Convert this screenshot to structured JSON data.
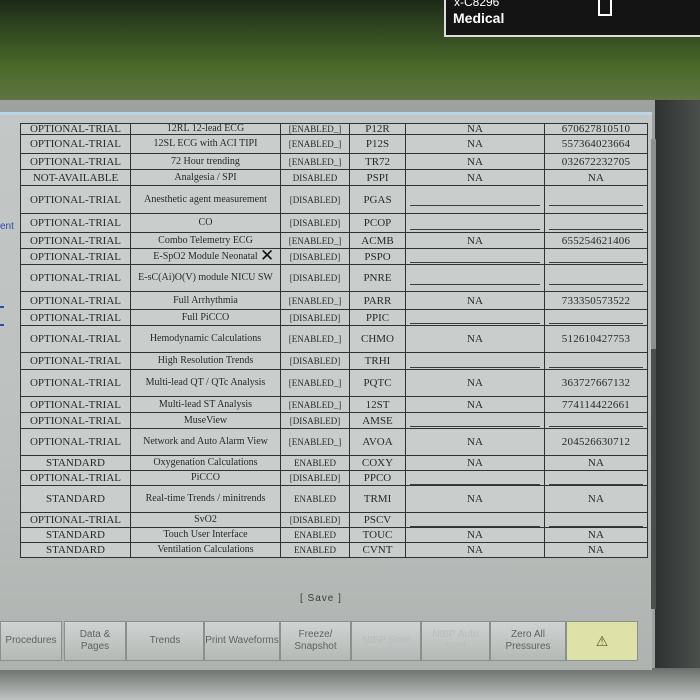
{
  "sticker": {
    "line1": "x-C8296",
    "line2": "Medical"
  },
  "side_hint": "ent",
  "table": {
    "rows": [
      {
        "license": "OPTIONAL-TRIAL",
        "name": "12RL 12-lead ECG",
        "status": "[ENABLED_]",
        "code": "P12R",
        "na": "NA",
        "key": "670627810510"
      },
      {
        "license": "OPTIONAL-TRIAL",
        "name": "12SL ECG with ACI TIPI",
        "status": "[ENABLED_]",
        "code": "P12S",
        "na": "NA",
        "key": "557364023664"
      },
      {
        "license": "OPTIONAL-TRIAL",
        "name": "72 Hour trending",
        "status": "[ENABLED_]",
        "code": "TR72",
        "na": "NA",
        "key": "032672232705"
      },
      {
        "license": "NOT-AVAILABLE",
        "name": "Analgesia / SPI",
        "status": "DISABLED",
        "code": "PSPI",
        "na": "NA",
        "key": "NA"
      },
      {
        "license": "OPTIONAL-TRIAL",
        "name": "Anesthetic agent measurement",
        "status": "[DISABLED]",
        "code": "PGAS",
        "na": "",
        "key": ""
      },
      {
        "license": "OPTIONAL-TRIAL",
        "name": "CO",
        "status": "[DISABLED]",
        "code": "PCOP",
        "na": "",
        "key": ""
      },
      {
        "license": "OPTIONAL-TRIAL",
        "name": "Combo Telemetry ECG",
        "status": "[ENABLED_]",
        "code": "ACMB",
        "na": "NA",
        "key": "655254621406"
      },
      {
        "license": "OPTIONAL-TRIAL",
        "name": "E-SpO2 Module Neonatal",
        "status": "[DISABLED]",
        "code": "PSPO",
        "na": "",
        "key": ""
      },
      {
        "license": "OPTIONAL-TRIAL",
        "name": "E-sC(Ai)O(V) module NICU SW",
        "status": "[DISABLED]",
        "code": "PNRE",
        "na": "",
        "key": ""
      },
      {
        "license": "OPTIONAL-TRIAL",
        "name": "Full Arrhythmia",
        "status": "[ENABLED_]",
        "code": "PARR",
        "na": "NA",
        "key": "733350573522"
      },
      {
        "license": "OPTIONAL-TRIAL",
        "name": "Full PiCCO",
        "status": "[DISABLED]",
        "code": "PPIC",
        "na": "",
        "key": ""
      },
      {
        "license": "OPTIONAL-TRIAL",
        "name": "Hemodynamic Calculations",
        "status": "[ENABLED_]",
        "code": "CHMO",
        "na": "NA",
        "key": "512610427753"
      },
      {
        "license": "OPTIONAL-TRIAL",
        "name": "High Resolution Trends",
        "status": "[DISABLED]",
        "code": "TRHI",
        "na": "",
        "key": ""
      },
      {
        "license": "OPTIONAL-TRIAL",
        "name": "Multi-lead QT / QTc Analysis",
        "status": "[ENABLED_]",
        "code": "PQTC",
        "na": "NA",
        "key": "363727667132"
      },
      {
        "license": "OPTIONAL-TRIAL",
        "name": "Multi-lead ST Analysis",
        "status": "[ENABLED_]",
        "code": "12ST",
        "na": "NA",
        "key": "774114422661"
      },
      {
        "license": "OPTIONAL-TRIAL",
        "name": "MuseView",
        "status": "[DISABLED]",
        "code": "AMSE",
        "na": "",
        "key": ""
      },
      {
        "license": "OPTIONAL-TRIAL",
        "name": "Network and Auto Alarm View",
        "status": "[ENABLED_]",
        "code": "AVOA",
        "na": "NA",
        "key": "204526630712"
      },
      {
        "license": "STANDARD",
        "name": "Oxygenation Calculations",
        "status": "ENABLED",
        "code": "COXY",
        "na": "NA",
        "key": "NA"
      },
      {
        "license": "OPTIONAL-TRIAL",
        "name": "PiCCO",
        "status": "[DISABLED]",
        "code": "PPCO",
        "na": "",
        "key": ""
      },
      {
        "license": "STANDARD",
        "name": "Real-time Trends / minitrends",
        "status": "ENABLED",
        "code": "TRMI",
        "na": "NA",
        "key": "NA"
      },
      {
        "license": "OPTIONAL-TRIAL",
        "name": "SvO2",
        "status": "[DISABLED]",
        "code": "PSCV",
        "na": "",
        "key": ""
      },
      {
        "license": "STANDARD",
        "name": "Touch User Interface",
        "status": "ENABLED",
        "code": "TOUC",
        "na": "NA",
        "key": "NA"
      },
      {
        "license": "STANDARD",
        "name": "Ventilation Calculations",
        "status": "ENABLED",
        "code": "CVNT",
        "na": "NA",
        "key": "NA"
      }
    ]
  },
  "save_label": "[ Save ]",
  "toolbar": {
    "buttons": [
      {
        "label": "Procedures",
        "state": "normal"
      },
      {
        "label": "Data & Pages",
        "state": "normal"
      },
      {
        "label": "Trends",
        "state": "normal"
      },
      {
        "label": "Print Waveforms",
        "state": "normal"
      },
      {
        "label": "Freeze/ Snapshot",
        "state": "normal"
      },
      {
        "label": "NIBP Start",
        "state": "disabled"
      },
      {
        "label": "NIBP Auto Start",
        "state": "disabled"
      },
      {
        "label": "Zero All Pressures",
        "state": "normal"
      },
      {
        "label": "",
        "state": "alarm",
        "icon": "alarm-bell-icon"
      }
    ]
  }
}
